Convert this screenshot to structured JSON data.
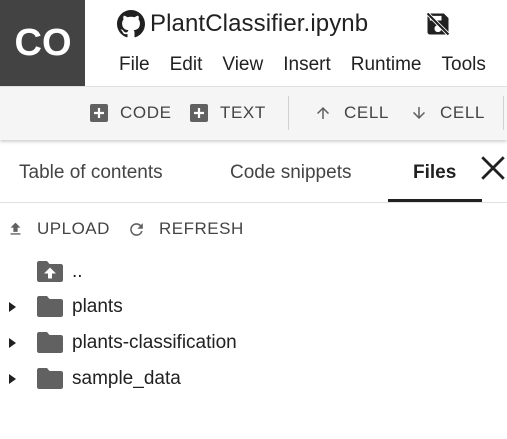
{
  "app": {
    "logo_text": "CO",
    "notebook_title": "PlantClassifier.ipynb"
  },
  "menu": {
    "items": [
      "File",
      "Edit",
      "View",
      "Insert",
      "Runtime",
      "Tools"
    ]
  },
  "toolbar": {
    "code_label": "CODE",
    "text_label": "TEXT",
    "cell_up_label": "CELL",
    "cell_down_label": "CELL"
  },
  "sidebar": {
    "tabs": [
      {
        "label": "Table of contents",
        "active": false
      },
      {
        "label": "Code snippets",
        "active": false
      },
      {
        "label": "Files",
        "active": true
      }
    ],
    "upload_label": "UPLOAD",
    "refresh_label": "REFRESH",
    "files": [
      {
        "name": "..",
        "type": "parent"
      },
      {
        "name": "plants",
        "type": "folder"
      },
      {
        "name": "plants-classification",
        "type": "folder"
      },
      {
        "name": "sample_data",
        "type": "folder"
      }
    ]
  },
  "colors": {
    "logo_bg": "#434343",
    "toolbar_bg": "#f5f5f5",
    "icon_gray": "#616161",
    "text_dark": "#212121"
  }
}
